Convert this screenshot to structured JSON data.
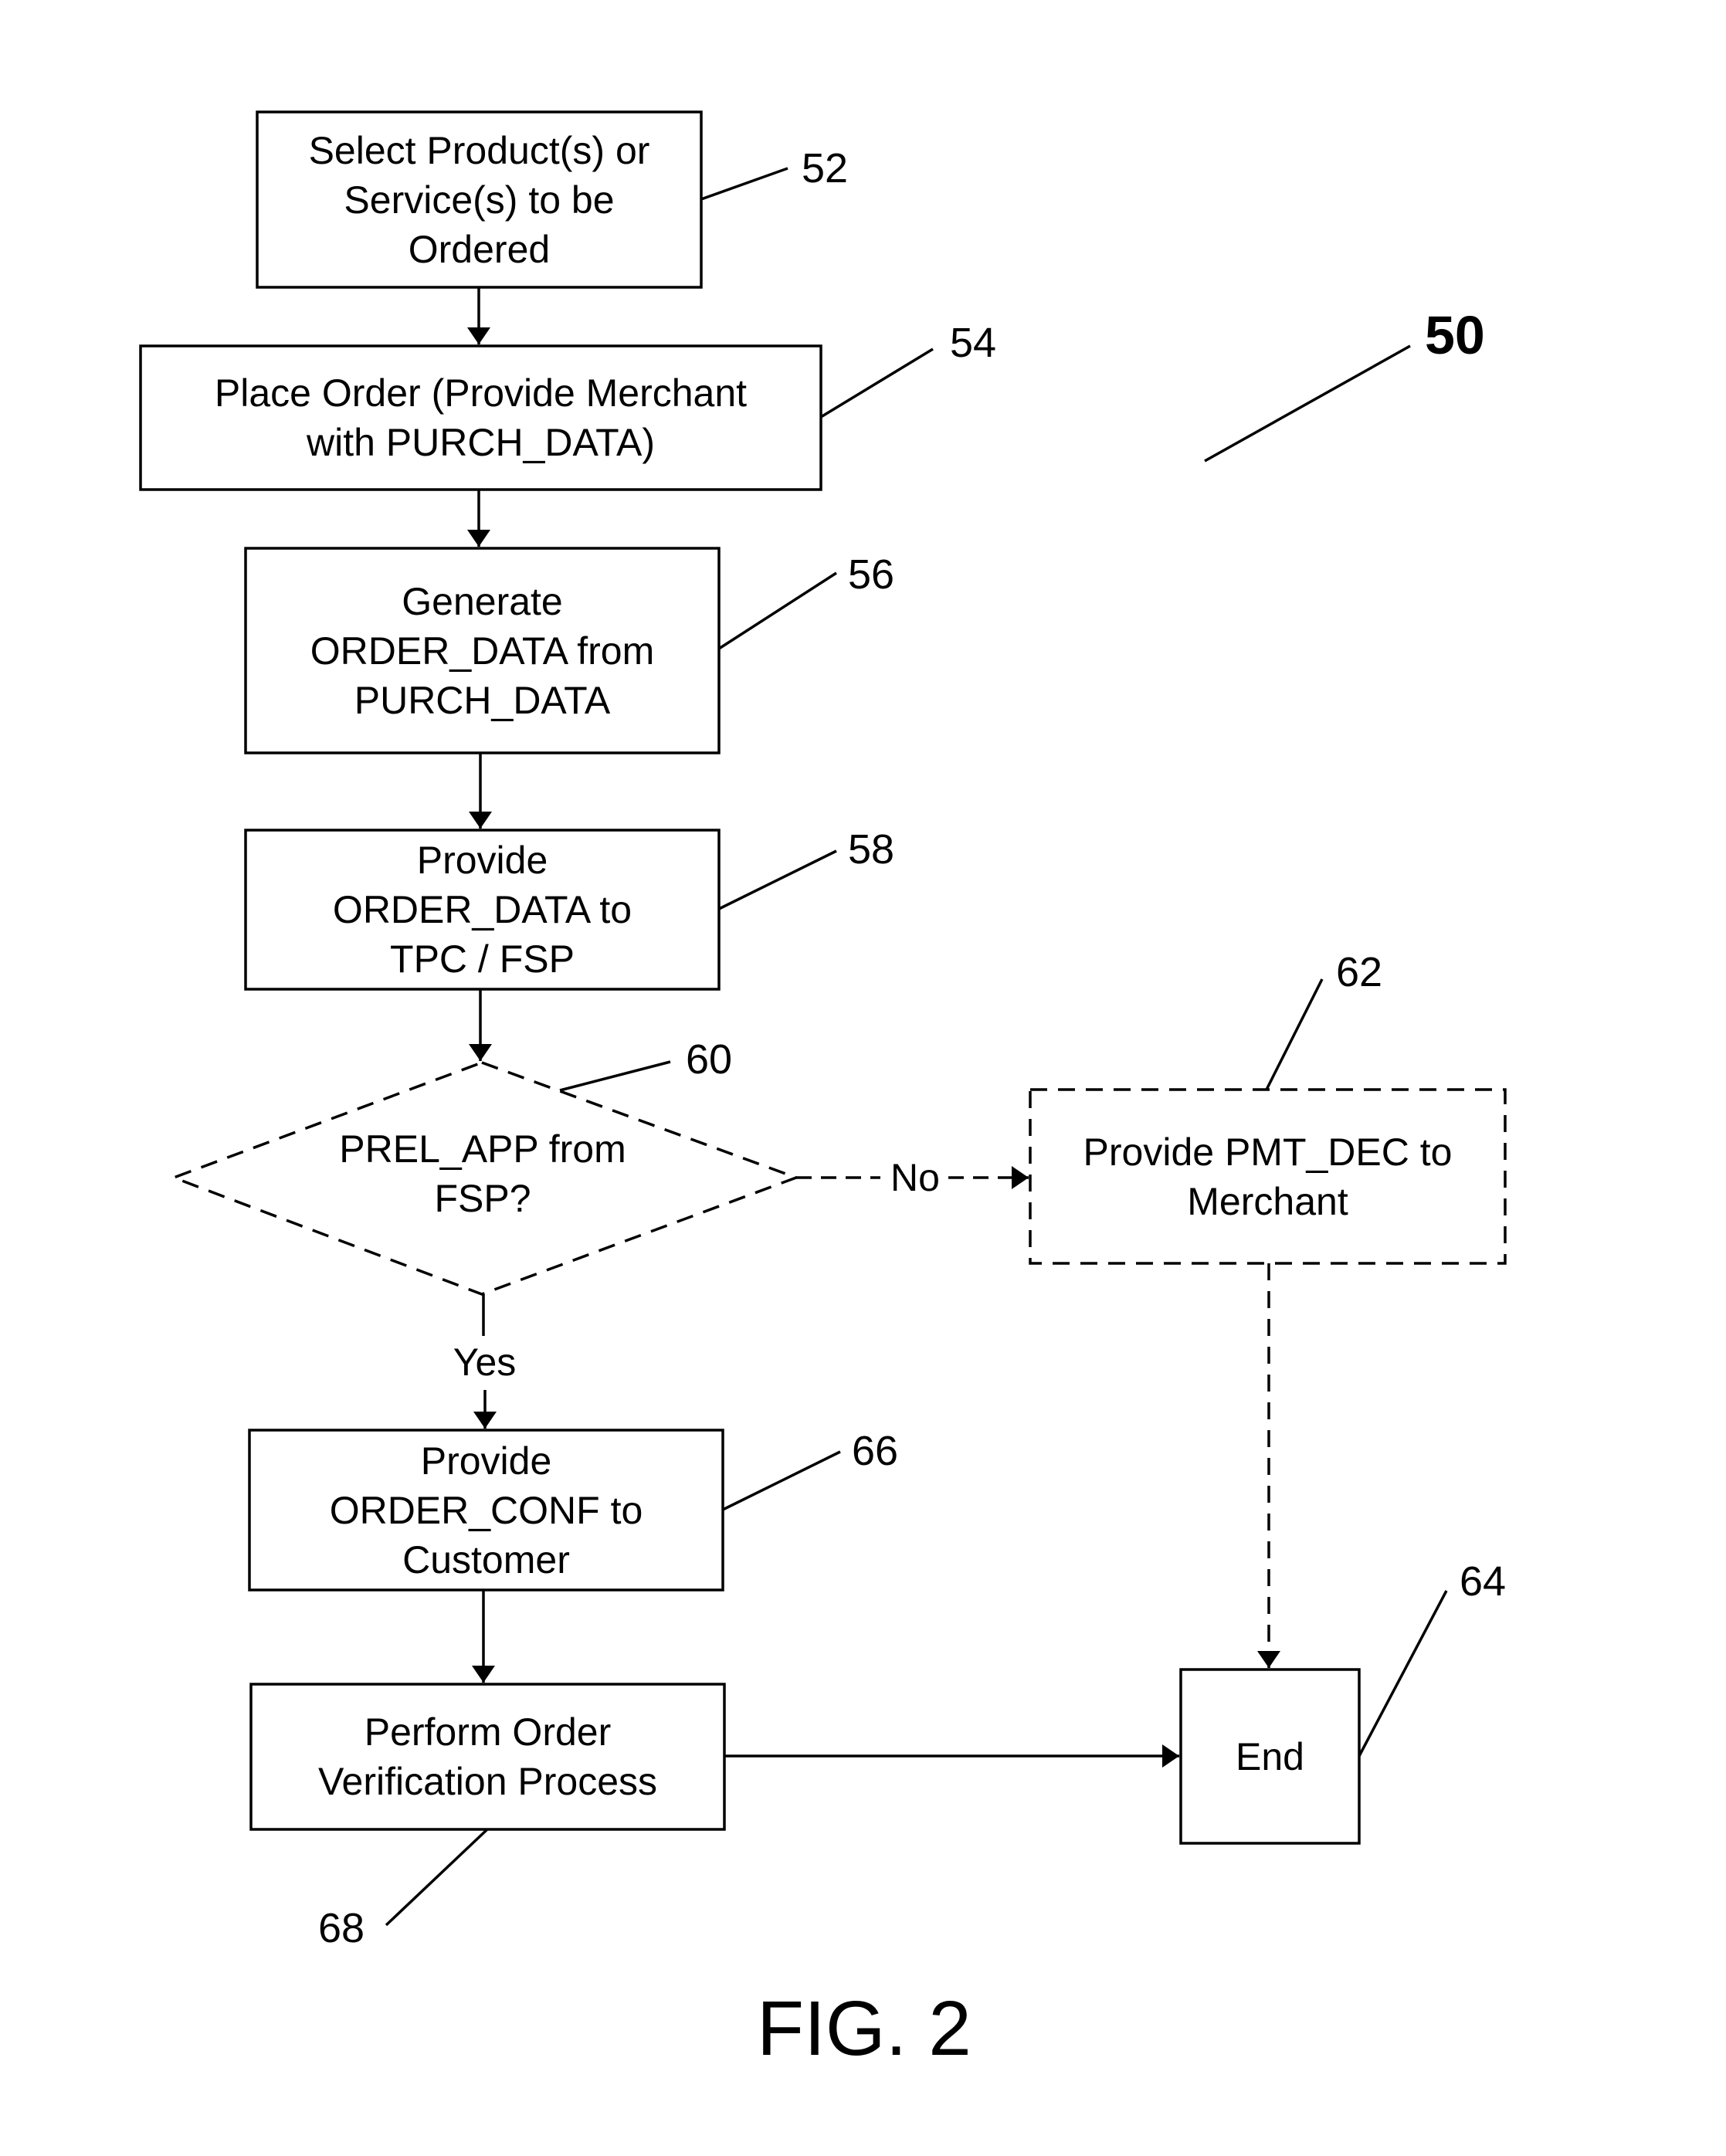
{
  "figure": {
    "reference": "50",
    "caption": "FIG. 2"
  },
  "steps": [
    {
      "id": "52",
      "label": "Select Product(s) or\nService(s) to be\nOrdered",
      "style": "solid"
    },
    {
      "id": "54",
      "label": "Place Order (Provide Merchant\nwith PURCH_DATA)",
      "style": "solid"
    },
    {
      "id": "56",
      "label": "Generate\nORDER_DATA from\nPURCH_DATA",
      "style": "solid"
    },
    {
      "id": "58",
      "label": "Provide\nORDER_DATA to\nTPC / FSP",
      "style": "solid"
    },
    {
      "id": "60",
      "label": "PREL_APP from\nFSP?",
      "style": "dashed-decision"
    },
    {
      "id": "62",
      "label": "Provide PMT_DEC to\nMerchant",
      "style": "dashed"
    },
    {
      "id": "66",
      "label": "Provide\nORDER_CONF to\nCustomer",
      "style": "solid"
    },
    {
      "id": "68",
      "label": "Perform Order\nVerification Process",
      "style": "solid"
    },
    {
      "id": "64",
      "label": "End",
      "style": "solid"
    }
  ],
  "branches": {
    "no": "No",
    "yes": "Yes"
  }
}
